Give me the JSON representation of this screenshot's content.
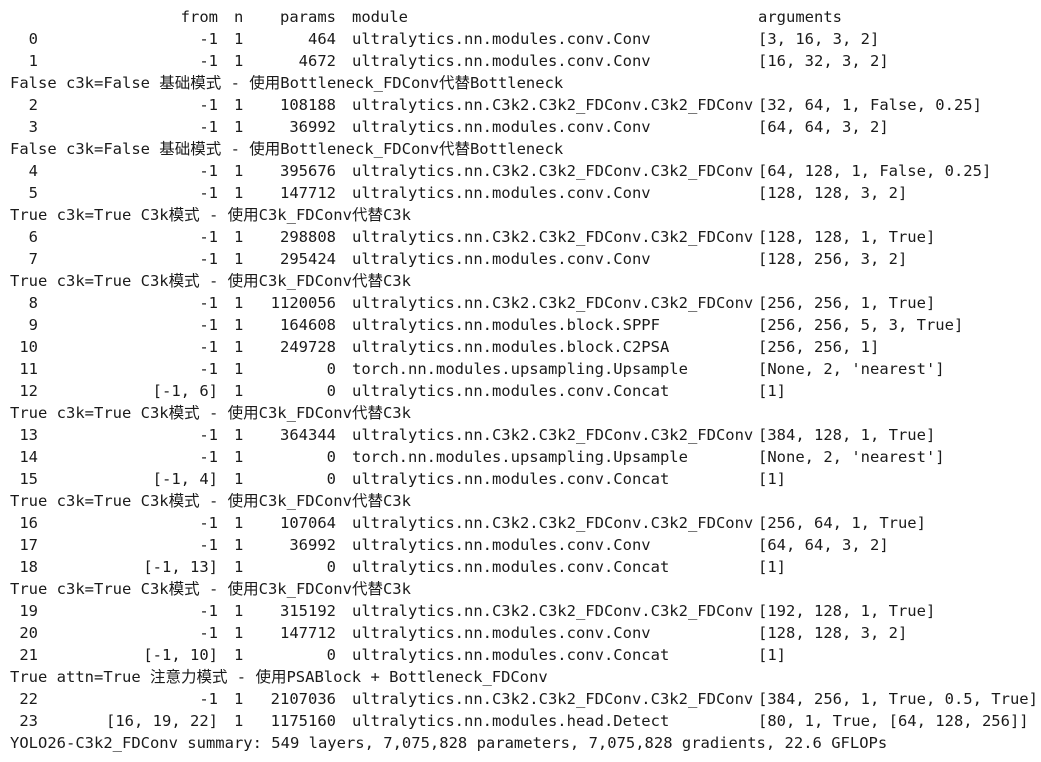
{
  "header": {
    "from": "from",
    "n": "n",
    "params": "params",
    "module": "module",
    "arguments": "arguments"
  },
  "lines": [
    {
      "type": "row",
      "idx": "0",
      "from": "-1",
      "n": "1",
      "params": "464",
      "module": "ultralytics.nn.modules.conv.Conv",
      "args": "[3, 16, 3, 2]"
    },
    {
      "type": "row",
      "idx": "1",
      "from": "-1",
      "n": "1",
      "params": "4672",
      "module": "ultralytics.nn.modules.conv.Conv",
      "args": "[16, 32, 3, 2]"
    },
    {
      "type": "msg",
      "text": "False c3k=False 基础模式 - 使用Bottleneck_FDConv代替Bottleneck"
    },
    {
      "type": "row",
      "idx": "2",
      "from": "-1",
      "n": "1",
      "params": "108188",
      "module": "ultralytics.nn.C3k2.C3k2_FDConv.C3k2_FDConv",
      "args": "[32, 64, 1, False, 0.25]"
    },
    {
      "type": "row",
      "idx": "3",
      "from": "-1",
      "n": "1",
      "params": "36992",
      "module": "ultralytics.nn.modules.conv.Conv",
      "args": "[64, 64, 3, 2]"
    },
    {
      "type": "msg",
      "text": "False c3k=False 基础模式 - 使用Bottleneck_FDConv代替Bottleneck"
    },
    {
      "type": "row",
      "idx": "4",
      "from": "-1",
      "n": "1",
      "params": "395676",
      "module": "ultralytics.nn.C3k2.C3k2_FDConv.C3k2_FDConv",
      "args": "[64, 128, 1, False, 0.25]"
    },
    {
      "type": "row",
      "idx": "5",
      "from": "-1",
      "n": "1",
      "params": "147712",
      "module": "ultralytics.nn.modules.conv.Conv",
      "args": "[128, 128, 3, 2]"
    },
    {
      "type": "msg",
      "text": "True c3k=True C3k模式 - 使用C3k_FDConv代替C3k"
    },
    {
      "type": "row",
      "idx": "6",
      "from": "-1",
      "n": "1",
      "params": "298808",
      "module": "ultralytics.nn.C3k2.C3k2_FDConv.C3k2_FDConv",
      "args": "[128, 128, 1, True]"
    },
    {
      "type": "row",
      "idx": "7",
      "from": "-1",
      "n": "1",
      "params": "295424",
      "module": "ultralytics.nn.modules.conv.Conv",
      "args": "[128, 256, 3, 2]"
    },
    {
      "type": "msg",
      "text": "True c3k=True C3k模式 - 使用C3k_FDConv代替C3k"
    },
    {
      "type": "row",
      "idx": "8",
      "from": "-1",
      "n": "1",
      "params": "1120056",
      "module": "ultralytics.nn.C3k2.C3k2_FDConv.C3k2_FDConv",
      "args": "[256, 256, 1, True]"
    },
    {
      "type": "row",
      "idx": "9",
      "from": "-1",
      "n": "1",
      "params": "164608",
      "module": "ultralytics.nn.modules.block.SPPF",
      "args": "[256, 256, 5, 3, True]"
    },
    {
      "type": "row",
      "idx": "10",
      "from": "-1",
      "n": "1",
      "params": "249728",
      "module": "ultralytics.nn.modules.block.C2PSA",
      "args": "[256, 256, 1]"
    },
    {
      "type": "row",
      "idx": "11",
      "from": "-1",
      "n": "1",
      "params": "0",
      "module": "torch.nn.modules.upsampling.Upsample",
      "args": "[None, 2, 'nearest']"
    },
    {
      "type": "row",
      "idx": "12",
      "from": "[-1, 6]",
      "n": "1",
      "params": "0",
      "module": "ultralytics.nn.modules.conv.Concat",
      "args": "[1]"
    },
    {
      "type": "msg",
      "text": "True c3k=True C3k模式 - 使用C3k_FDConv代替C3k"
    },
    {
      "type": "row",
      "idx": "13",
      "from": "-1",
      "n": "1",
      "params": "364344",
      "module": "ultralytics.nn.C3k2.C3k2_FDConv.C3k2_FDConv",
      "args": "[384, 128, 1, True]"
    },
    {
      "type": "row",
      "idx": "14",
      "from": "-1",
      "n": "1",
      "params": "0",
      "module": "torch.nn.modules.upsampling.Upsample",
      "args": "[None, 2, 'nearest']"
    },
    {
      "type": "row",
      "idx": "15",
      "from": "[-1, 4]",
      "n": "1",
      "params": "0",
      "module": "ultralytics.nn.modules.conv.Concat",
      "args": "[1]"
    },
    {
      "type": "msg",
      "text": "True c3k=True C3k模式 - 使用C3k_FDConv代替C3k"
    },
    {
      "type": "row",
      "idx": "16",
      "from": "-1",
      "n": "1",
      "params": "107064",
      "module": "ultralytics.nn.C3k2.C3k2_FDConv.C3k2_FDConv",
      "args": "[256, 64, 1, True]"
    },
    {
      "type": "row",
      "idx": "17",
      "from": "-1",
      "n": "1",
      "params": "36992",
      "module": "ultralytics.nn.modules.conv.Conv",
      "args": "[64, 64, 3, 2]"
    },
    {
      "type": "row",
      "idx": "18",
      "from": "[-1, 13]",
      "n": "1",
      "params": "0",
      "module": "ultralytics.nn.modules.conv.Concat",
      "args": "[1]"
    },
    {
      "type": "msg",
      "text": "True c3k=True C3k模式 - 使用C3k_FDConv代替C3k"
    },
    {
      "type": "row",
      "idx": "19",
      "from": "-1",
      "n": "1",
      "params": "315192",
      "module": "ultralytics.nn.C3k2.C3k2_FDConv.C3k2_FDConv",
      "args": "[192, 128, 1, True]"
    },
    {
      "type": "row",
      "idx": "20",
      "from": "-1",
      "n": "1",
      "params": "147712",
      "module": "ultralytics.nn.modules.conv.Conv",
      "args": "[128, 128, 3, 2]"
    },
    {
      "type": "row",
      "idx": "21",
      "from": "[-1, 10]",
      "n": "1",
      "params": "0",
      "module": "ultralytics.nn.modules.conv.Concat",
      "args": "[1]"
    },
    {
      "type": "msg",
      "text": "True attn=True 注意力模式 - 使用PSABlock + Bottleneck_FDConv"
    },
    {
      "type": "row",
      "idx": "22",
      "from": "-1",
      "n": "1",
      "params": "2107036",
      "module": "ultralytics.nn.C3k2.C3k2_FDConv.C3k2_FDConv",
      "args": "[384, 256, 1, True, 0.5, True]"
    },
    {
      "type": "row",
      "idx": "23",
      "from": "[16, 19, 22]",
      "n": "1",
      "params": "1175160",
      "module": "ultralytics.nn.modules.head.Detect",
      "args": "[80, 1, True, [64, 128, 256]]"
    },
    {
      "type": "msg",
      "text": "YOLO26-C3k2_FDConv summary: 549 layers, 7,075,828 parameters, 7,075,828 gradients, 22.6 GFLOPs"
    }
  ]
}
